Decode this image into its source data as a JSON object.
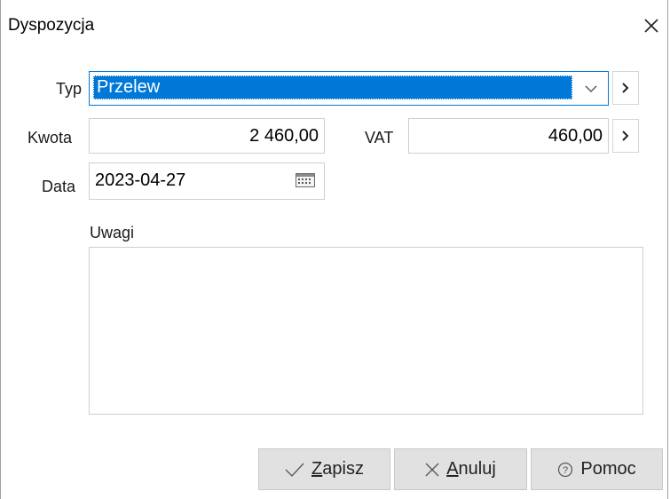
{
  "dialog": {
    "title": "Dyspozycja"
  },
  "icons": {
    "close": "close-icon",
    "dropdown": "chevron-down-icon",
    "more": "chevron-right-icon",
    "calendar": "calendar-icon",
    "check": "check-icon",
    "cancel": "x-icon",
    "help": "help-icon"
  },
  "form": {
    "typ_label": "Typ",
    "typ_value": "Przelew",
    "kwota_label": "Kwota",
    "kwota_value": "2 460,00",
    "vat_label": "VAT",
    "vat_value": "460,00",
    "data_label": "Data",
    "data_value": "2023-04-27",
    "uwagi_label": "Uwagi",
    "uwagi_value": ""
  },
  "buttons": {
    "save_key": "Z",
    "save_rest": "apisz",
    "cancel_key": "A",
    "cancel_rest": "nuluj",
    "help_label": "Pomoc"
  },
  "colors": {
    "selection": "#0078d7",
    "button_bg": "#e1e1e1"
  }
}
